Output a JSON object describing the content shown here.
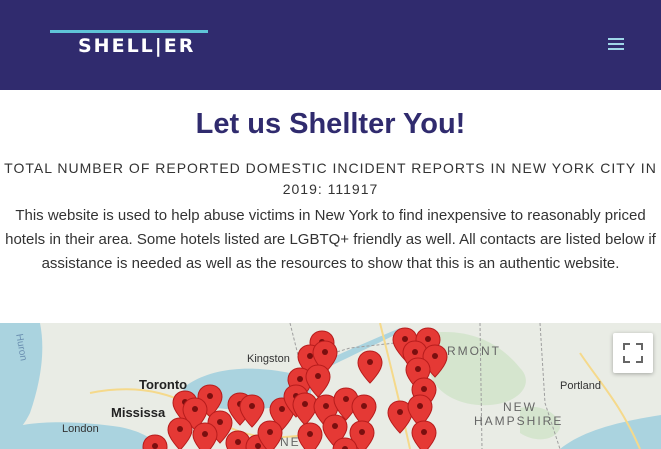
{
  "header": {
    "logo_text": "SHELL|ER",
    "menu_icon": "hamburger-menu-icon",
    "background_color": "#302b6e",
    "accent_color": "#5fc4d8"
  },
  "main": {
    "title": "Let us Shellter You!",
    "stats_text": "TOTAL NUMBER OF REPORTED DOMESTIC INCIDENT REPORTS IN NEW YORK CITY IN 2019: 111917",
    "description": "This website is used to help abuse victims in New York to find inexpensive to reasonably priced hotels in their area. Some hotels listed are LGBTQ+ friendly as well. All contacts are listed below if assistance is needed as well as the resources to show that this is an authentic website."
  },
  "map": {
    "labels": {
      "kingston": "Kingston",
      "toronto": "Toronto",
      "mississauga": "Mississa",
      "london": "London",
      "vermont": "RMONT",
      "portland": "Portland",
      "new_hampshire_1": "NEW",
      "new_hampshire_2": "HAMPSHIRE",
      "huron": "Huron",
      "new_york_partial": "NE"
    },
    "fullscreen_icon": "fullscreen-icon",
    "marker_color": "#e53935"
  }
}
